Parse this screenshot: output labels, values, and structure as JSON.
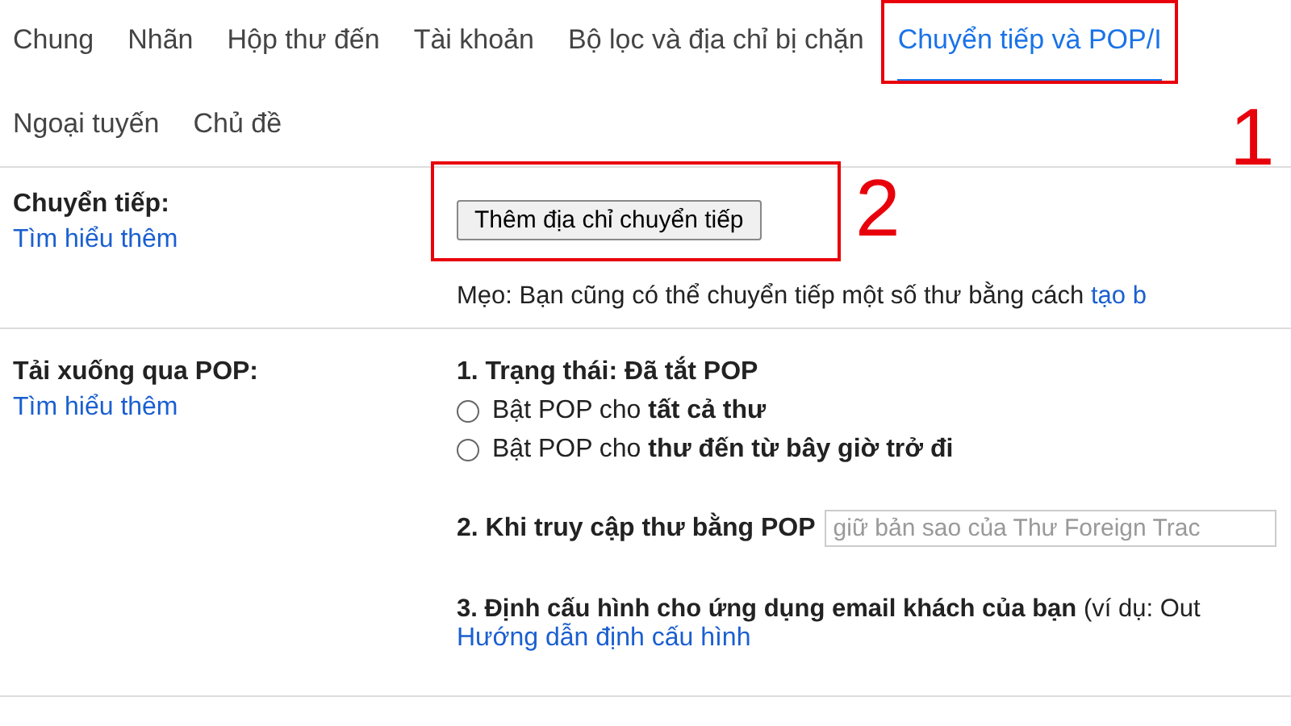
{
  "tabs": [
    {
      "label": "Chung",
      "selected": false
    },
    {
      "label": "Nhãn",
      "selected": false
    },
    {
      "label": "Hộp thư đến",
      "selected": false
    },
    {
      "label": "Tài khoản",
      "selected": false
    },
    {
      "label": "Bộ lọc và địa chỉ bị chặn",
      "selected": false
    },
    {
      "label": "Chuyển tiếp và POP/I",
      "selected": true
    },
    {
      "label": "Ngoại tuyến",
      "selected": false
    },
    {
      "label": "Chủ đề",
      "selected": false
    }
  ],
  "forwarding": {
    "title": "Chuyển tiếp:",
    "learn_more": "Tìm hiểu thêm",
    "button": "Thêm địa chỉ chuyển tiếp",
    "tip": "Mẹo: Bạn cũng có thể chuyển tiếp một số thư bằng cách",
    "tip_link": "tạo b"
  },
  "pop": {
    "title": "Tải xuống qua POP:",
    "learn_more": "Tìm hiểu thêm",
    "status": "1. Trạng thái: Đã tắt POP",
    "options": [
      {
        "label": "Bật POP cho **tất cả thư**",
        "selected": false
      },
      {
        "label": "Bật POP cho **thư đến từ bây giờ trở đi**",
        "selected": false
      }
    ],
    "access_label": "2. Khi truy cập thư bằng POP",
    "access_value": "giữ bản sao của Thư Foreign Trac",
    "configure": "**3. Định cấu hình cho ứng dụng email khách của bạn** (ví dụ: Out",
    "configure_link": "Hướng dẫn định cấu hình"
  },
  "annotations": [
    "1",
    "2"
  ]
}
